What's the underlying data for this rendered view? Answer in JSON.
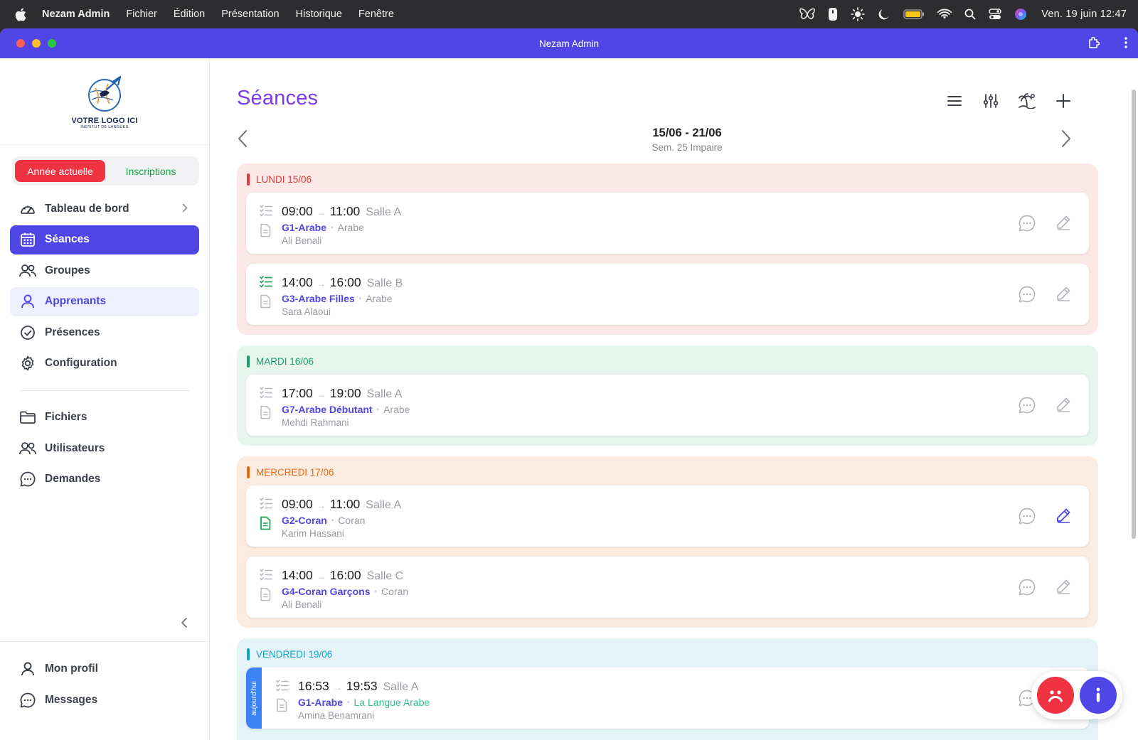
{
  "menubar": {
    "app_name": "Nezam Admin",
    "menus": [
      "Fichier",
      "Édition",
      "Présentation",
      "Historique",
      "Fenêtre"
    ],
    "clock": "Ven. 19 juin  12:47"
  },
  "window": {
    "title": "Nezam Admin"
  },
  "sidebar": {
    "logo_text": "VOTRE LOGO ICI",
    "logo_subtext": "INSTITUT DE LANGUES",
    "segment": {
      "current_year": "Année actuelle",
      "inscriptions": "Inscriptions"
    },
    "items": [
      {
        "label": "Tableau de bord",
        "icon": "gauge-icon"
      },
      {
        "label": "Séances",
        "icon": "calendar-icon"
      },
      {
        "label": "Groupes",
        "icon": "users-icon"
      },
      {
        "label": "Apprenants",
        "icon": "user-icon"
      },
      {
        "label": "Présences",
        "icon": "check-circle-icon"
      },
      {
        "label": "Configuration",
        "icon": "gear-icon"
      }
    ],
    "items2": [
      {
        "label": "Fichiers",
        "icon": "folder-icon"
      },
      {
        "label": "Utilisateurs",
        "icon": "users-icon"
      },
      {
        "label": "Demandes",
        "icon": "chat-icon"
      }
    ],
    "bottom": [
      {
        "label": "Mon profil",
        "icon": "user-icon"
      },
      {
        "label": "Messages",
        "icon": "chat-icon"
      }
    ]
  },
  "main": {
    "title": "Séances",
    "week": {
      "range": "15/06 - 21/06",
      "sub": "Sem. 25 Impaire"
    },
    "days": [
      {
        "label": "LUNDI 15/06",
        "sessions": [
          {
            "start": "09:00",
            "end": "11:00",
            "room": "Salle A",
            "group": "G1-Arabe",
            "subject": "Arabe",
            "teacher": "Ali Benali"
          },
          {
            "start": "14:00",
            "end": "16:00",
            "room": "Salle B",
            "group": "G3-Arabe Filles",
            "subject": "Arabe",
            "teacher": "Sara Alaoui"
          }
        ]
      },
      {
        "label": "MARDI 16/06",
        "sessions": [
          {
            "start": "17:00",
            "end": "19:00",
            "room": "Salle A",
            "group": "G7-Arabe Débutant",
            "subject": "Arabe",
            "teacher": "Mehdi Rahmani"
          }
        ]
      },
      {
        "label": "MERCREDI 17/06",
        "sessions": [
          {
            "start": "09:00",
            "end": "11:00",
            "room": "Salle A",
            "group": "G2-Coran",
            "subject": "Coran",
            "teacher": "Karim Hassani"
          },
          {
            "start": "14:00",
            "end": "16:00",
            "room": "Salle C",
            "group": "G4-Coran Garçons",
            "subject": "Coran",
            "teacher": "Ali Benali"
          }
        ]
      },
      {
        "label": "VENDREDI 19/06",
        "today_label": "aujourd'hui",
        "sessions": [
          {
            "start": "16:53",
            "end": "19:53",
            "room": "Salle A",
            "group": "G1-Arabe",
            "subject": "La Langue Arabe",
            "teacher": "Amina Benamrani"
          }
        ]
      }
    ]
  },
  "colors": {
    "accent": "#4f46e5",
    "title": "#7c3aed",
    "red": "#ef3340",
    "green": "#16a34a",
    "monday_bg": "#fde8e8",
    "tuesday_bg": "#e6f5ee",
    "wednesday_bg": "#fcebe0",
    "friday_bg": "#e3f3f8"
  }
}
